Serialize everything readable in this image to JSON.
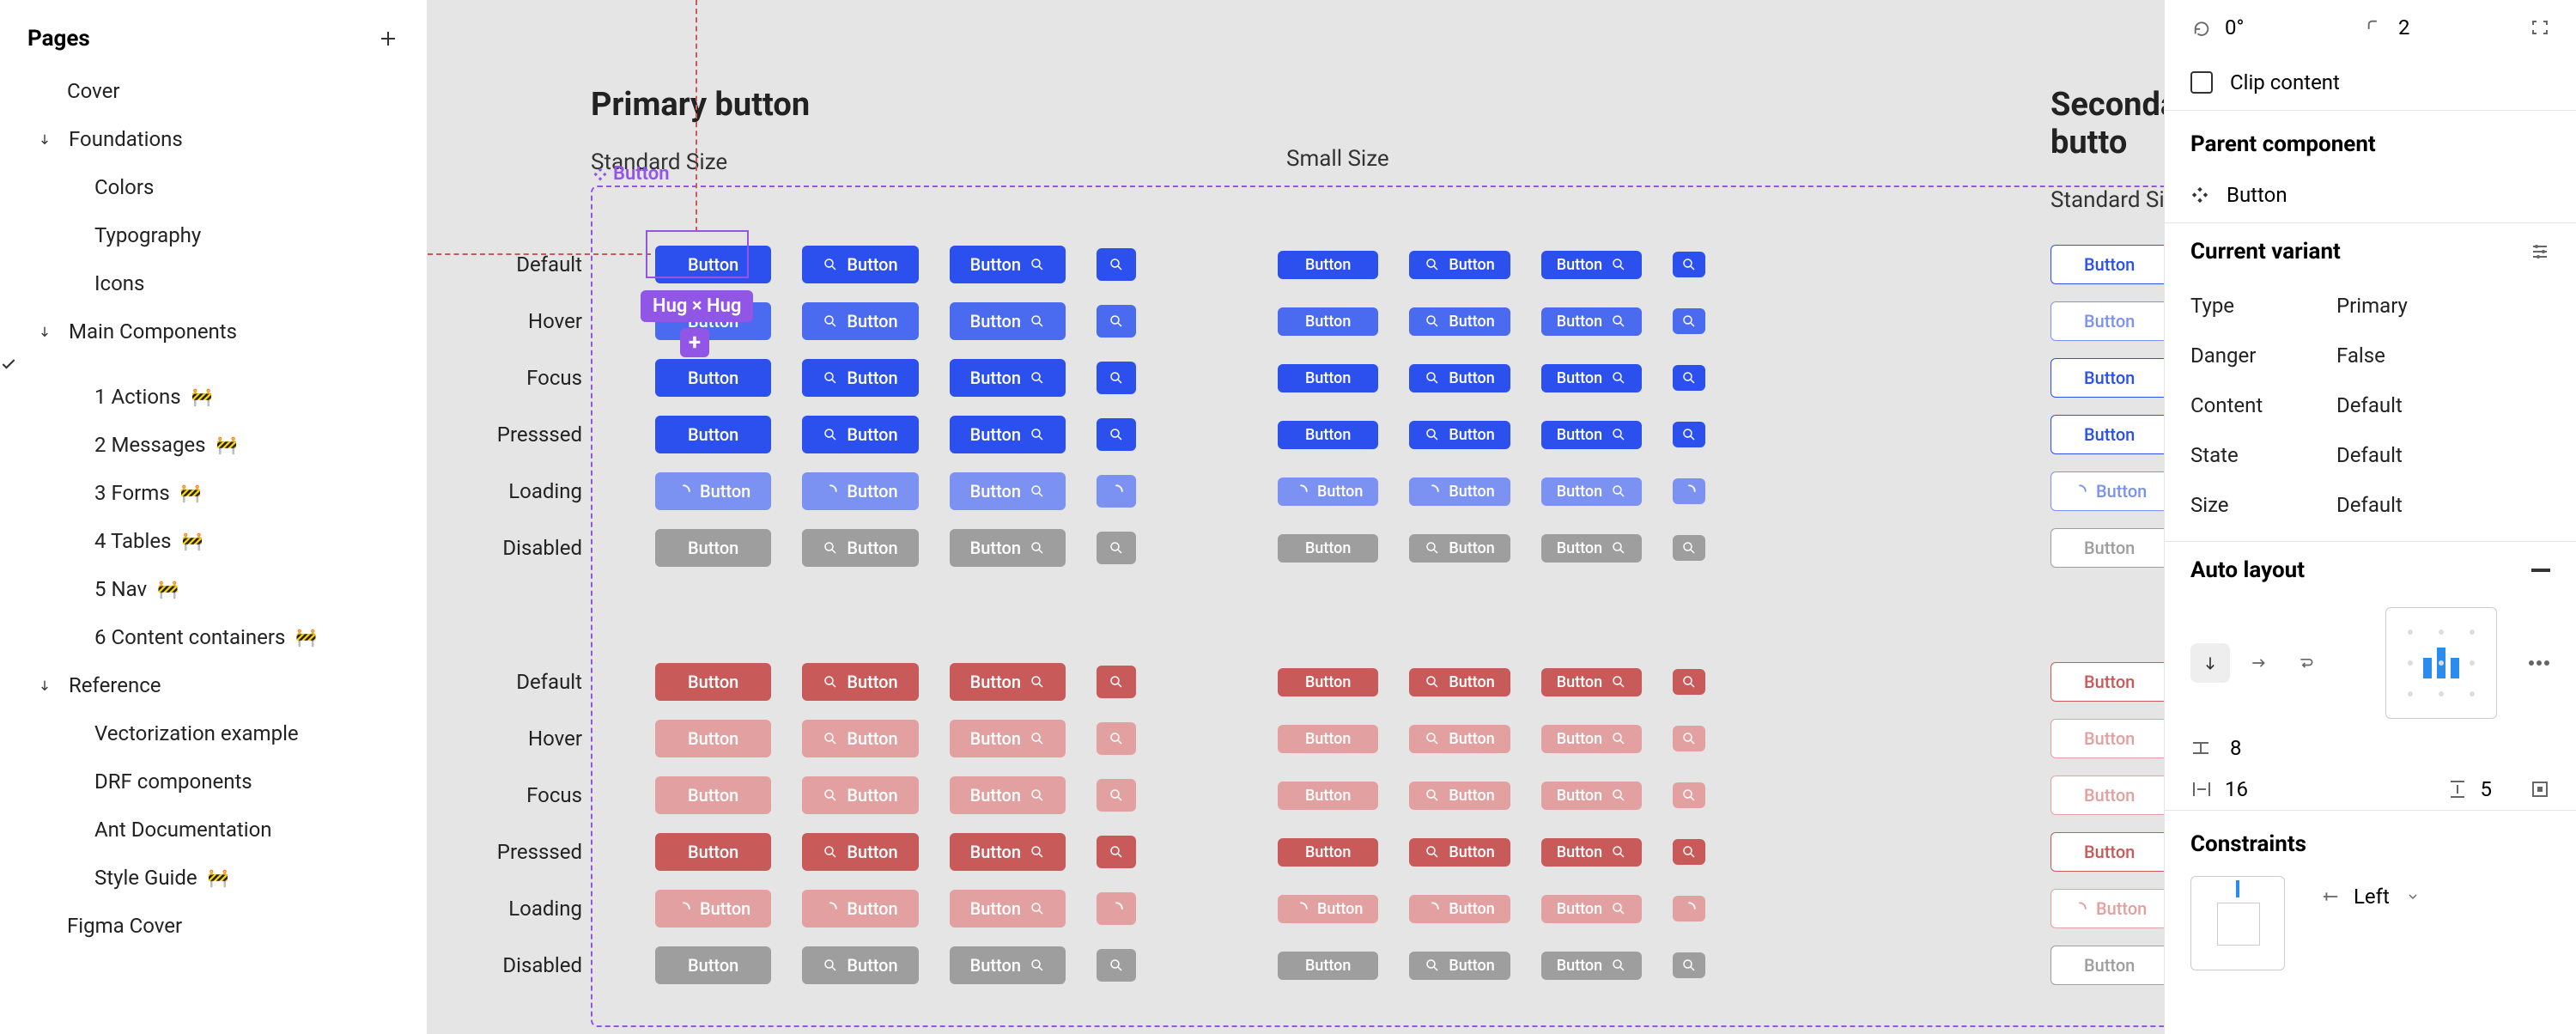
{
  "sidebar": {
    "title": "Pages",
    "items": [
      {
        "label": "Cover",
        "depth": 0
      },
      {
        "label": "Foundations",
        "depth": 0,
        "caret": "down"
      },
      {
        "label": "Colors",
        "depth": 1
      },
      {
        "label": "Typography",
        "depth": 1
      },
      {
        "label": "Icons",
        "depth": 1
      },
      {
        "label": "Main Components",
        "depth": 0,
        "caret": "down"
      },
      {
        "label": "1 Actions",
        "depth": 1,
        "wip": true,
        "checked": true
      },
      {
        "label": "2 Messages",
        "depth": 1,
        "wip": true
      },
      {
        "label": "3 Forms",
        "depth": 1,
        "wip": true
      },
      {
        "label": "4 Tables",
        "depth": 1,
        "wip": true
      },
      {
        "label": "5 Nav",
        "depth": 1,
        "wip": true
      },
      {
        "label": "6 Content containers",
        "depth": 1,
        "wip": true
      },
      {
        "label": "Reference",
        "depth": 0,
        "caret": "down"
      },
      {
        "label": "Vectorization example",
        "depth": 1
      },
      {
        "label": "DRF components",
        "depth": 1
      },
      {
        "label": "Ant Documentation",
        "depth": 1
      },
      {
        "label": "Style Guide",
        "depth": 1,
        "wip": true
      },
      {
        "label": "Figma Cover",
        "depth": 0
      }
    ],
    "wip_glyph": "🚧"
  },
  "canvas": {
    "primary_heading": "Primary button",
    "secondary_heading": "Secondary butto",
    "standard_size": "Standard Size",
    "small_size": "Small Size",
    "component_tag": "Button",
    "hug_label": "Hug × Hug",
    "row_states": [
      "Default",
      "Hover",
      "Focus",
      "Presssed",
      "Loading",
      "Disabled"
    ],
    "button_label": "Button",
    "colors": {
      "primary": "#2b50ed",
      "primary_hover": "#4a6af0",
      "primary_loading": "#7c92f2",
      "danger": "#c85a5a",
      "danger_hover": "#e3a0a0",
      "disabled": "#9e9e9e",
      "selection": "#9256e6"
    }
  },
  "inspector": {
    "rotation": "0°",
    "corner_radius": "2",
    "clip_content_label": "Clip content",
    "parent_component_title": "Parent component",
    "parent_component_name": "Button",
    "current_variant_title": "Current variant",
    "variant_props": {
      "Type": "Primary",
      "Danger": "False",
      "Content": "Default",
      "State": "Default",
      "Size": "Default"
    },
    "auto_layout_title": "Auto layout",
    "auto_layout": {
      "direction": "vertical",
      "spacing": "8",
      "padding_h": "16",
      "padding_v": "5"
    },
    "constraints_title": "Constraints",
    "constraints_h": "Left"
  }
}
